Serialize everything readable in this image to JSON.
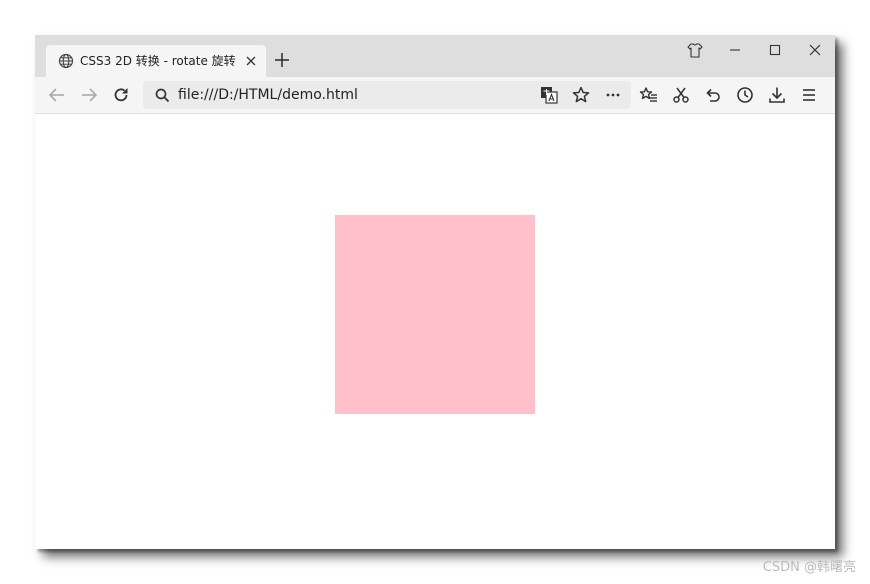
{
  "browser": {
    "tab": {
      "title": "CSS3 2D 转换 - rotate 旋转",
      "icon": "globe-icon"
    },
    "url": "file:///D:/HTML/demo.html"
  },
  "page": {
    "box_color": "#ffc0cb"
  },
  "watermark": "CSDN @韩曙亮"
}
